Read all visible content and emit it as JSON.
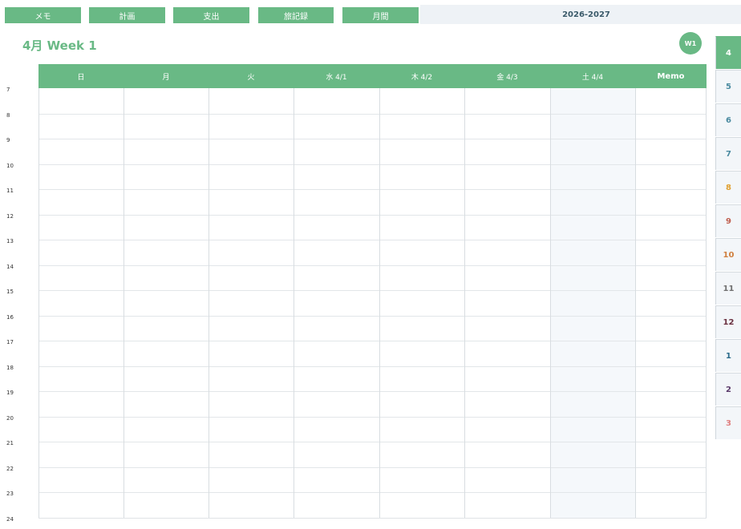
{
  "top_tabs": [
    {
      "label": "メモ"
    },
    {
      "label": "計画"
    },
    {
      "label": "支出"
    },
    {
      "label": "旅記録"
    },
    {
      "label": "月間"
    }
  ],
  "year_label": "2026-2027",
  "page_title": "4月  Week 1",
  "week_badge": "W1",
  "day_headers": [
    "日",
    "月",
    "火",
    "水 4/1",
    "木 4/2",
    "金 4/3",
    "土 4/4",
    "Memo"
  ],
  "hours": [
    "7",
    "8",
    "9",
    "10",
    "11",
    "12",
    "13",
    "14",
    "15",
    "16",
    "17",
    "18",
    "19",
    "20",
    "21",
    "22",
    "23",
    "24"
  ],
  "month_tabs": [
    {
      "label": "4",
      "color": "#ffffff",
      "active": true
    },
    {
      "label": "5",
      "color": "#4a8aa0"
    },
    {
      "label": "6",
      "color": "#4a8aa0"
    },
    {
      "label": "7",
      "color": "#4a8aa0"
    },
    {
      "label": "8",
      "color": "#e0a030"
    },
    {
      "label": "9",
      "color": "#c06050"
    },
    {
      "label": "10",
      "color": "#d08040"
    },
    {
      "label": "11",
      "color": "#707070"
    },
    {
      "label": "12",
      "color": "#6a3040"
    },
    {
      "label": "1",
      "color": "#2a6a8a"
    },
    {
      "label": "2",
      "color": "#5a3a6a"
    },
    {
      "label": "3",
      "color": "#e08080"
    }
  ],
  "accent_color": "#69b985"
}
